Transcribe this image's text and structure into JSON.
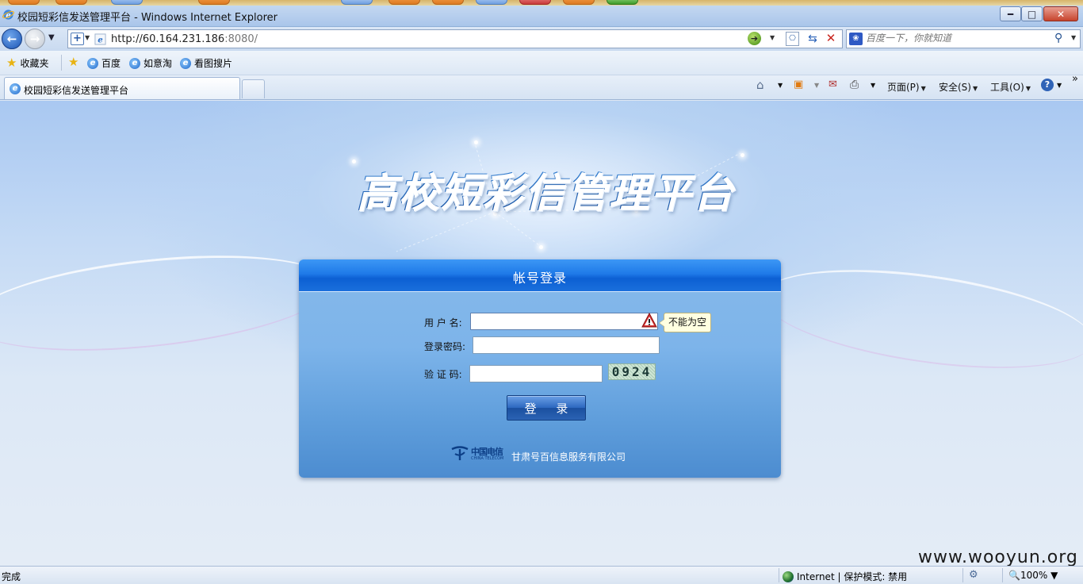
{
  "window": {
    "title": "校园短彩信发送管理平台 - Windows Internet Explorer",
    "min_glyph": "━",
    "max_glyph": "□",
    "close_glyph": "✕"
  },
  "address_bar": {
    "url_host": "http://60.164.231.186",
    "url_port": ":8080/",
    "search_placeholder": "百度一下，你就知道"
  },
  "favorites_bar": {
    "favorites_label": "收藏夹",
    "items": [
      {
        "label": "百度"
      },
      {
        "label": "如意淘"
      },
      {
        "label": "看图搜片"
      }
    ]
  },
  "tabs": {
    "active_label": "校园短彩信发送管理平台"
  },
  "command_bar": {
    "page_label": "页面(P)",
    "safety_label": "安全(S)",
    "tools_label": "工具(O)",
    "more_glyph": "»"
  },
  "page": {
    "platform_title": "高校短彩信管理平台",
    "login": {
      "header_title": "帐号登录",
      "username_label": "用 户 名:",
      "username_value": "",
      "username_error": "不能为空",
      "password_label": "登录密码:",
      "password_value": "",
      "captcha_label": "验 证 码:",
      "captcha_value": "",
      "captcha_code": "0924",
      "submit_label": "登 录",
      "company": "甘肃号百信息服务有限公司",
      "logo_cn": "中国电信",
      "logo_en": "CHINA TELECOM"
    }
  },
  "watermark": "www.wooyun.org",
  "status_bar": {
    "status": "完成",
    "zone": "Internet | 保护模式: 禁用",
    "zoom": "100%"
  },
  "colors": {
    "login_header": "#1f7ae8",
    "login_panel": "#7db4ea",
    "title_blue": "#2a6fc0",
    "tooltip_bg": "#ffffe1"
  }
}
